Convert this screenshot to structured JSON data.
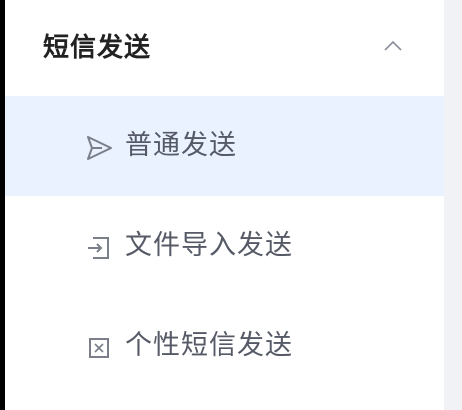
{
  "sidebar": {
    "group": {
      "title": "短信发送",
      "expanded": true,
      "chevron_icon": "chevron-up-icon"
    },
    "items": [
      {
        "label": "普通发送",
        "icon": "send-icon",
        "active": true
      },
      {
        "label": "文件导入发送",
        "icon": "file-import-icon",
        "active": false
      },
      {
        "label": "个性短信发送",
        "icon": "template-variable-icon",
        "active": false
      }
    ]
  },
  "colors": {
    "active_bg": "#ebf2ff",
    "text": "#555a66",
    "title": "#222222",
    "icon": "#7a7f8a"
  }
}
